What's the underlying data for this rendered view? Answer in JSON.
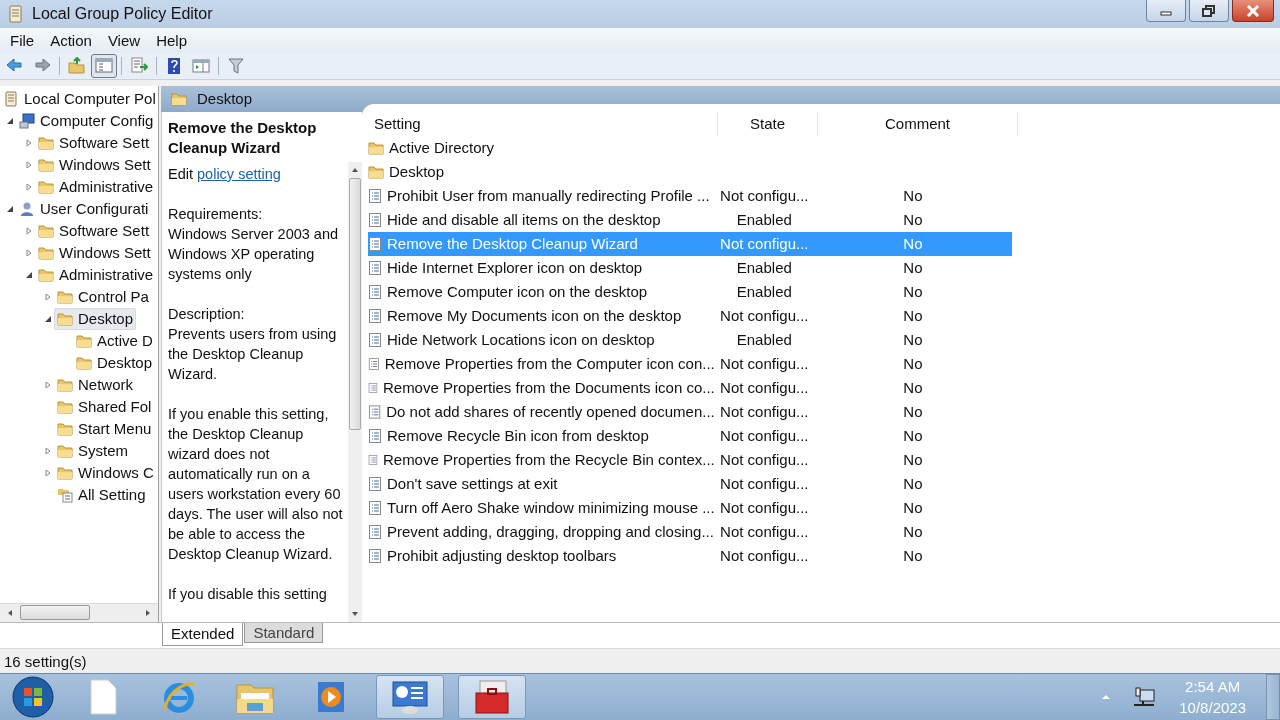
{
  "window": {
    "title": "Local Group Policy Editor"
  },
  "menu": [
    "File",
    "Action",
    "View",
    "Help"
  ],
  "toolbar": [
    {
      "kind": "back"
    },
    {
      "kind": "forward"
    },
    {
      "kind": "sep"
    },
    {
      "kind": "up"
    },
    {
      "kind": "tree",
      "selected": true
    },
    {
      "kind": "sep"
    },
    {
      "kind": "export"
    },
    {
      "kind": "sep"
    },
    {
      "kind": "help"
    },
    {
      "kind": "pane"
    },
    {
      "kind": "sep"
    },
    {
      "kind": "filter"
    }
  ],
  "tree": [
    {
      "label": "Local Computer Pol",
      "kind": "scroll",
      "selected": false,
      "children": [
        {
          "label": "Computer Config",
          "kind": "computer",
          "expanded": true,
          "selected": false,
          "children": [
            {
              "label": "Software Sett",
              "kind": "folder",
              "expanded": false,
              "selected": false
            },
            {
              "label": "Windows Sett",
              "kind": "folder",
              "expanded": false,
              "selected": false
            },
            {
              "label": "Administrative",
              "kind": "folder",
              "expanded": false,
              "selected": false
            }
          ]
        },
        {
          "label": "User Configurati",
          "kind": "user",
          "expanded": true,
          "selected": false,
          "children": [
            {
              "label": "Software Sett",
              "kind": "folder",
              "expanded": false,
              "selected": false
            },
            {
              "label": "Windows Sett",
              "kind": "folder",
              "expanded": false,
              "selected": false
            },
            {
              "label": "Administrative",
              "kind": "folder",
              "expanded": true,
              "selected": false,
              "children": [
                {
                  "label": "Control Pa",
                  "kind": "folder",
                  "expanded": false,
                  "selected": false
                },
                {
                  "label": "Desktop",
                  "kind": "folder",
                  "expanded": true,
                  "selected": true,
                  "children": [
                    {
                      "label": "Active D",
                      "kind": "folder",
                      "selected": false
                    },
                    {
                      "label": "Desktop",
                      "kind": "folder",
                      "selected": false
                    }
                  ]
                },
                {
                  "label": "Network",
                  "kind": "folder",
                  "expanded": false,
                  "selected": false
                },
                {
                  "label": "Shared Fol",
                  "kind": "folder",
                  "selected": false
                },
                {
                  "label": "Start Menu",
                  "kind": "folder",
                  "selected": false
                },
                {
                  "label": "System",
                  "kind": "folder",
                  "expanded": false,
                  "selected": false
                },
                {
                  "label": "Windows C",
                  "kind": "folder",
                  "expanded": false,
                  "selected": false
                },
                {
                  "label": "All Setting",
                  "kind": "settings",
                  "selected": false
                }
              ]
            }
          ]
        }
      ]
    }
  ],
  "header": {
    "title": "Desktop"
  },
  "description": {
    "title": "Remove the Desktop Cleanup Wizard",
    "edit_label": "Edit",
    "edit_link": "policy setting",
    "paragraphs": [
      {
        "heading": "Requirements:",
        "text": "Windows Server 2003 and Windows XP operating systems only"
      },
      {
        "heading": "Description:",
        "text": "Prevents users from using the Desktop Cleanup Wizard."
      },
      {
        "text": "If you enable this setting, the Desktop Cleanup wizard does not automatically run on a users workstation every 60 days. The user will also not be able to access the Desktop Cleanup Wizard."
      },
      {
        "text": "If you disable this setting"
      }
    ]
  },
  "table": {
    "columns": [
      "Setting",
      "State",
      "Comment"
    ],
    "rows": [
      {
        "kind": "folder",
        "setting": "Active Directory",
        "selected": false
      },
      {
        "kind": "folder",
        "setting": "Desktop",
        "selected": false
      },
      {
        "kind": "policy",
        "setting": "Prohibit User from manually redirecting Profile ...",
        "state": "Not configu...",
        "comment": "No",
        "selected": false
      },
      {
        "kind": "policy",
        "setting": "Hide and disable all items on the desktop",
        "state": "Enabled",
        "comment": "No",
        "selected": false
      },
      {
        "kind": "policy",
        "setting": "Remove the Desktop Cleanup Wizard",
        "state": "Not configu...",
        "comment": "No",
        "selected": true
      },
      {
        "kind": "policy",
        "setting": "Hide Internet Explorer icon on desktop",
        "state": "Enabled",
        "comment": "No",
        "selected": false
      },
      {
        "kind": "policy",
        "setting": "Remove Computer icon on the desktop",
        "state": "Enabled",
        "comment": "No",
        "selected": false
      },
      {
        "kind": "policy",
        "setting": "Remove My Documents icon on the desktop",
        "state": "Not configu...",
        "comment": "No",
        "selected": false
      },
      {
        "kind": "policy",
        "setting": "Hide Network Locations icon on desktop",
        "state": "Enabled",
        "comment": "No",
        "selected": false
      },
      {
        "kind": "policy",
        "setting": "Remove Properties from the Computer icon con...",
        "state": "Not configu...",
        "comment": "No",
        "selected": false
      },
      {
        "kind": "policy",
        "setting": "Remove Properties from the Documents icon co...",
        "state": "Not configu...",
        "comment": "No",
        "selected": false
      },
      {
        "kind": "policy",
        "setting": "Do not add shares of recently opened documen...",
        "state": "Not configu...",
        "comment": "No",
        "selected": false
      },
      {
        "kind": "policy",
        "setting": "Remove Recycle Bin icon from desktop",
        "state": "Not configu...",
        "comment": "No",
        "selected": false
      },
      {
        "kind": "policy",
        "setting": "Remove Properties from the Recycle Bin contex...",
        "state": "Not configu...",
        "comment": "No",
        "selected": false
      },
      {
        "kind": "policy",
        "setting": "Don't save settings at exit",
        "state": "Not configu...",
        "comment": "No",
        "selected": false
      },
      {
        "kind": "policy",
        "setting": "Turn off Aero Shake window minimizing mouse ...",
        "state": "Not configu...",
        "comment": "No",
        "selected": false
      },
      {
        "kind": "policy",
        "setting": "Prevent adding, dragging, dropping and closing...",
        "state": "Not configu...",
        "comment": "No",
        "selected": false
      },
      {
        "kind": "policy",
        "setting": "Prohibit adjusting desktop toolbars",
        "state": "Not configu...",
        "comment": "No",
        "selected": false
      }
    ]
  },
  "view_tabs": [
    {
      "label": "Extended",
      "selected": true
    },
    {
      "label": "Standard",
      "selected": false
    }
  ],
  "status_bar": {
    "text": "16 setting(s)"
  },
  "taskbar": {
    "items": [
      {
        "kind": "start"
      },
      {
        "kind": "file",
        "running": false
      },
      {
        "kind": "ie",
        "running": false
      },
      {
        "kind": "explorer",
        "running": false
      },
      {
        "kind": "media",
        "running": false
      },
      {
        "kind": "control",
        "running": true
      },
      {
        "kind": "toolbox",
        "running": true
      }
    ],
    "time": "2:54 AM",
    "date": "10/8/2023"
  }
}
